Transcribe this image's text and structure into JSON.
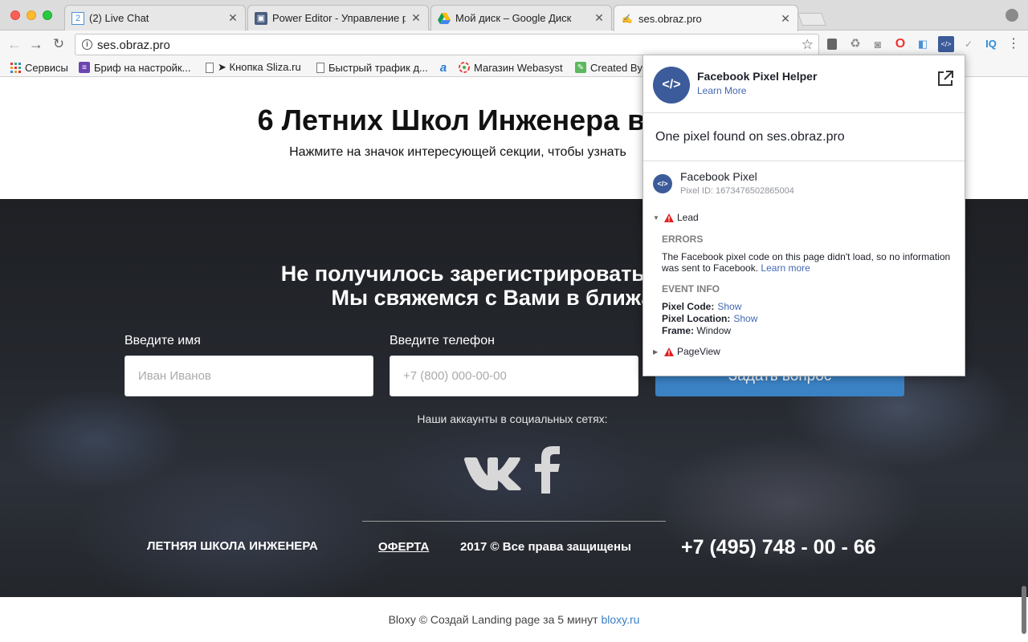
{
  "browser": {
    "tabs": [
      {
        "title": "(2) Live Chat",
        "icon": "chat-favicon-icon"
      },
      {
        "title": "Power Editor - Управление ре",
        "icon": "power-editor-favicon-icon"
      },
      {
        "title": "Мой диск – Google Диск",
        "icon": "google-drive-favicon-icon"
      },
      {
        "title": "ses.obraz.pro",
        "icon": "site-favicon-icon",
        "active": true
      }
    ],
    "url": "ses.obraz.pro",
    "bookmarks": [
      {
        "label": "Сервисы",
        "icon": "apps-grid-icon"
      },
      {
        "label": "Бриф на настройк...",
        "icon": "form-icon"
      },
      {
        "label": "➤ Кнопка Sliza.ru",
        "icon": "page-icon"
      },
      {
        "label": "Быстрый трафик д...",
        "icon": "page-icon"
      },
      {
        "label": "",
        "icon": "a-letter-icon"
      },
      {
        "label": "Магазин Webasyst",
        "icon": "webasyst-icon"
      },
      {
        "label": "Created By",
        "icon": "created-by-icon"
      }
    ]
  },
  "page": {
    "hero_title": "6 Летних Школ Инженера в",
    "hero_subtitle": "Нажмите на значок интересующей секции, чтобы узнать",
    "dark_title_line1": "Не получилось зарегистрироваться или ос",
    "dark_title_line2": "Мы свяжемся с Вами в ближайше",
    "name_label": "Введите имя",
    "name_placeholder": "Иван Иванов",
    "phone_label": "Введите телефон",
    "phone_placeholder": "+7 (800) 000-00-00",
    "submit_label": "Задать вопрос",
    "social_title": "Наши аккаунты в социальных сетях:",
    "footer_brand": "ЛЕТНЯЯ ШКОЛА ИНЖЕНЕРА",
    "footer_link": "ОФЕРТА",
    "footer_copy": "2017 © Все права защищены",
    "footer_phone": "+7 (495) 748 - 00 - 66",
    "bottom_text": "Bloxy © Создай Landing page за 5 минут",
    "bottom_link": "bloxy.ru"
  },
  "pixel_helper": {
    "title": "Facebook Pixel Helper",
    "learn_more": "Learn More",
    "found_text": "One pixel found on ses.obraz.pro",
    "pixel_name": "Facebook Pixel",
    "pixel_id": "Pixel ID: 1673476502865004",
    "event_lead": "Lead",
    "errors_title": "ERRORS",
    "error_text": "The Facebook pixel code on this page didn't load, so no information was sent to Facebook.",
    "error_link": "Learn more",
    "event_info_title": "EVENT INFO",
    "pixel_code_label": "Pixel Code:",
    "pixel_code_link": "Show",
    "pixel_location_label": "Pixel Location:",
    "pixel_location_link": "Show",
    "frame_label": "Frame:",
    "frame_value": "Window",
    "event_pageview": "PageView"
  },
  "colors": {
    "fb_blue": "#3b5b9a",
    "link_blue": "#4267b2",
    "warning_red": "#e02020",
    "submit_blue": "#3b82c4"
  }
}
